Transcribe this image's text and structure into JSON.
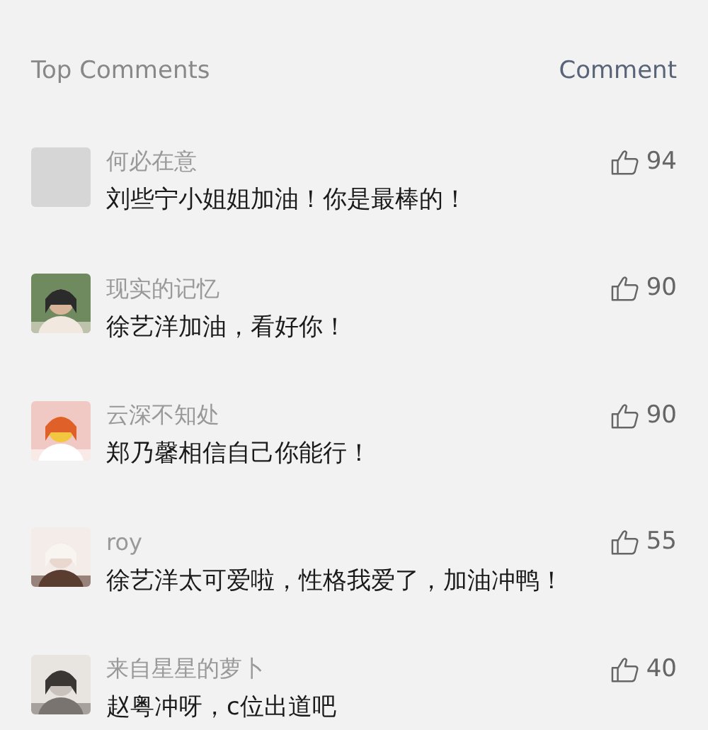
{
  "header": {
    "title": "Top Comments",
    "action": "Comment"
  },
  "comments": [
    {
      "avatar": {
        "kind": "blank"
      },
      "user": "何必在意",
      "text": "刘些宁小姐姐加油！你是最棒的！",
      "likes": "94"
    },
    {
      "user": "现实的记忆",
      "text": "徐艺洋加油，看好你！",
      "likes": "90"
    },
    {
      "user": "云深不知处",
      "text": "郑乃馨相信自己你能行！",
      "likes": "90"
    },
    {
      "user": "roy",
      "text": "徐艺洋太可爱啦，性格我爱了，加油冲鸭！",
      "likes": "55"
    },
    {
      "user": "来自星星的萝卜",
      "text": "赵粤冲呀，c位出道吧",
      "likes": "40"
    }
  ]
}
